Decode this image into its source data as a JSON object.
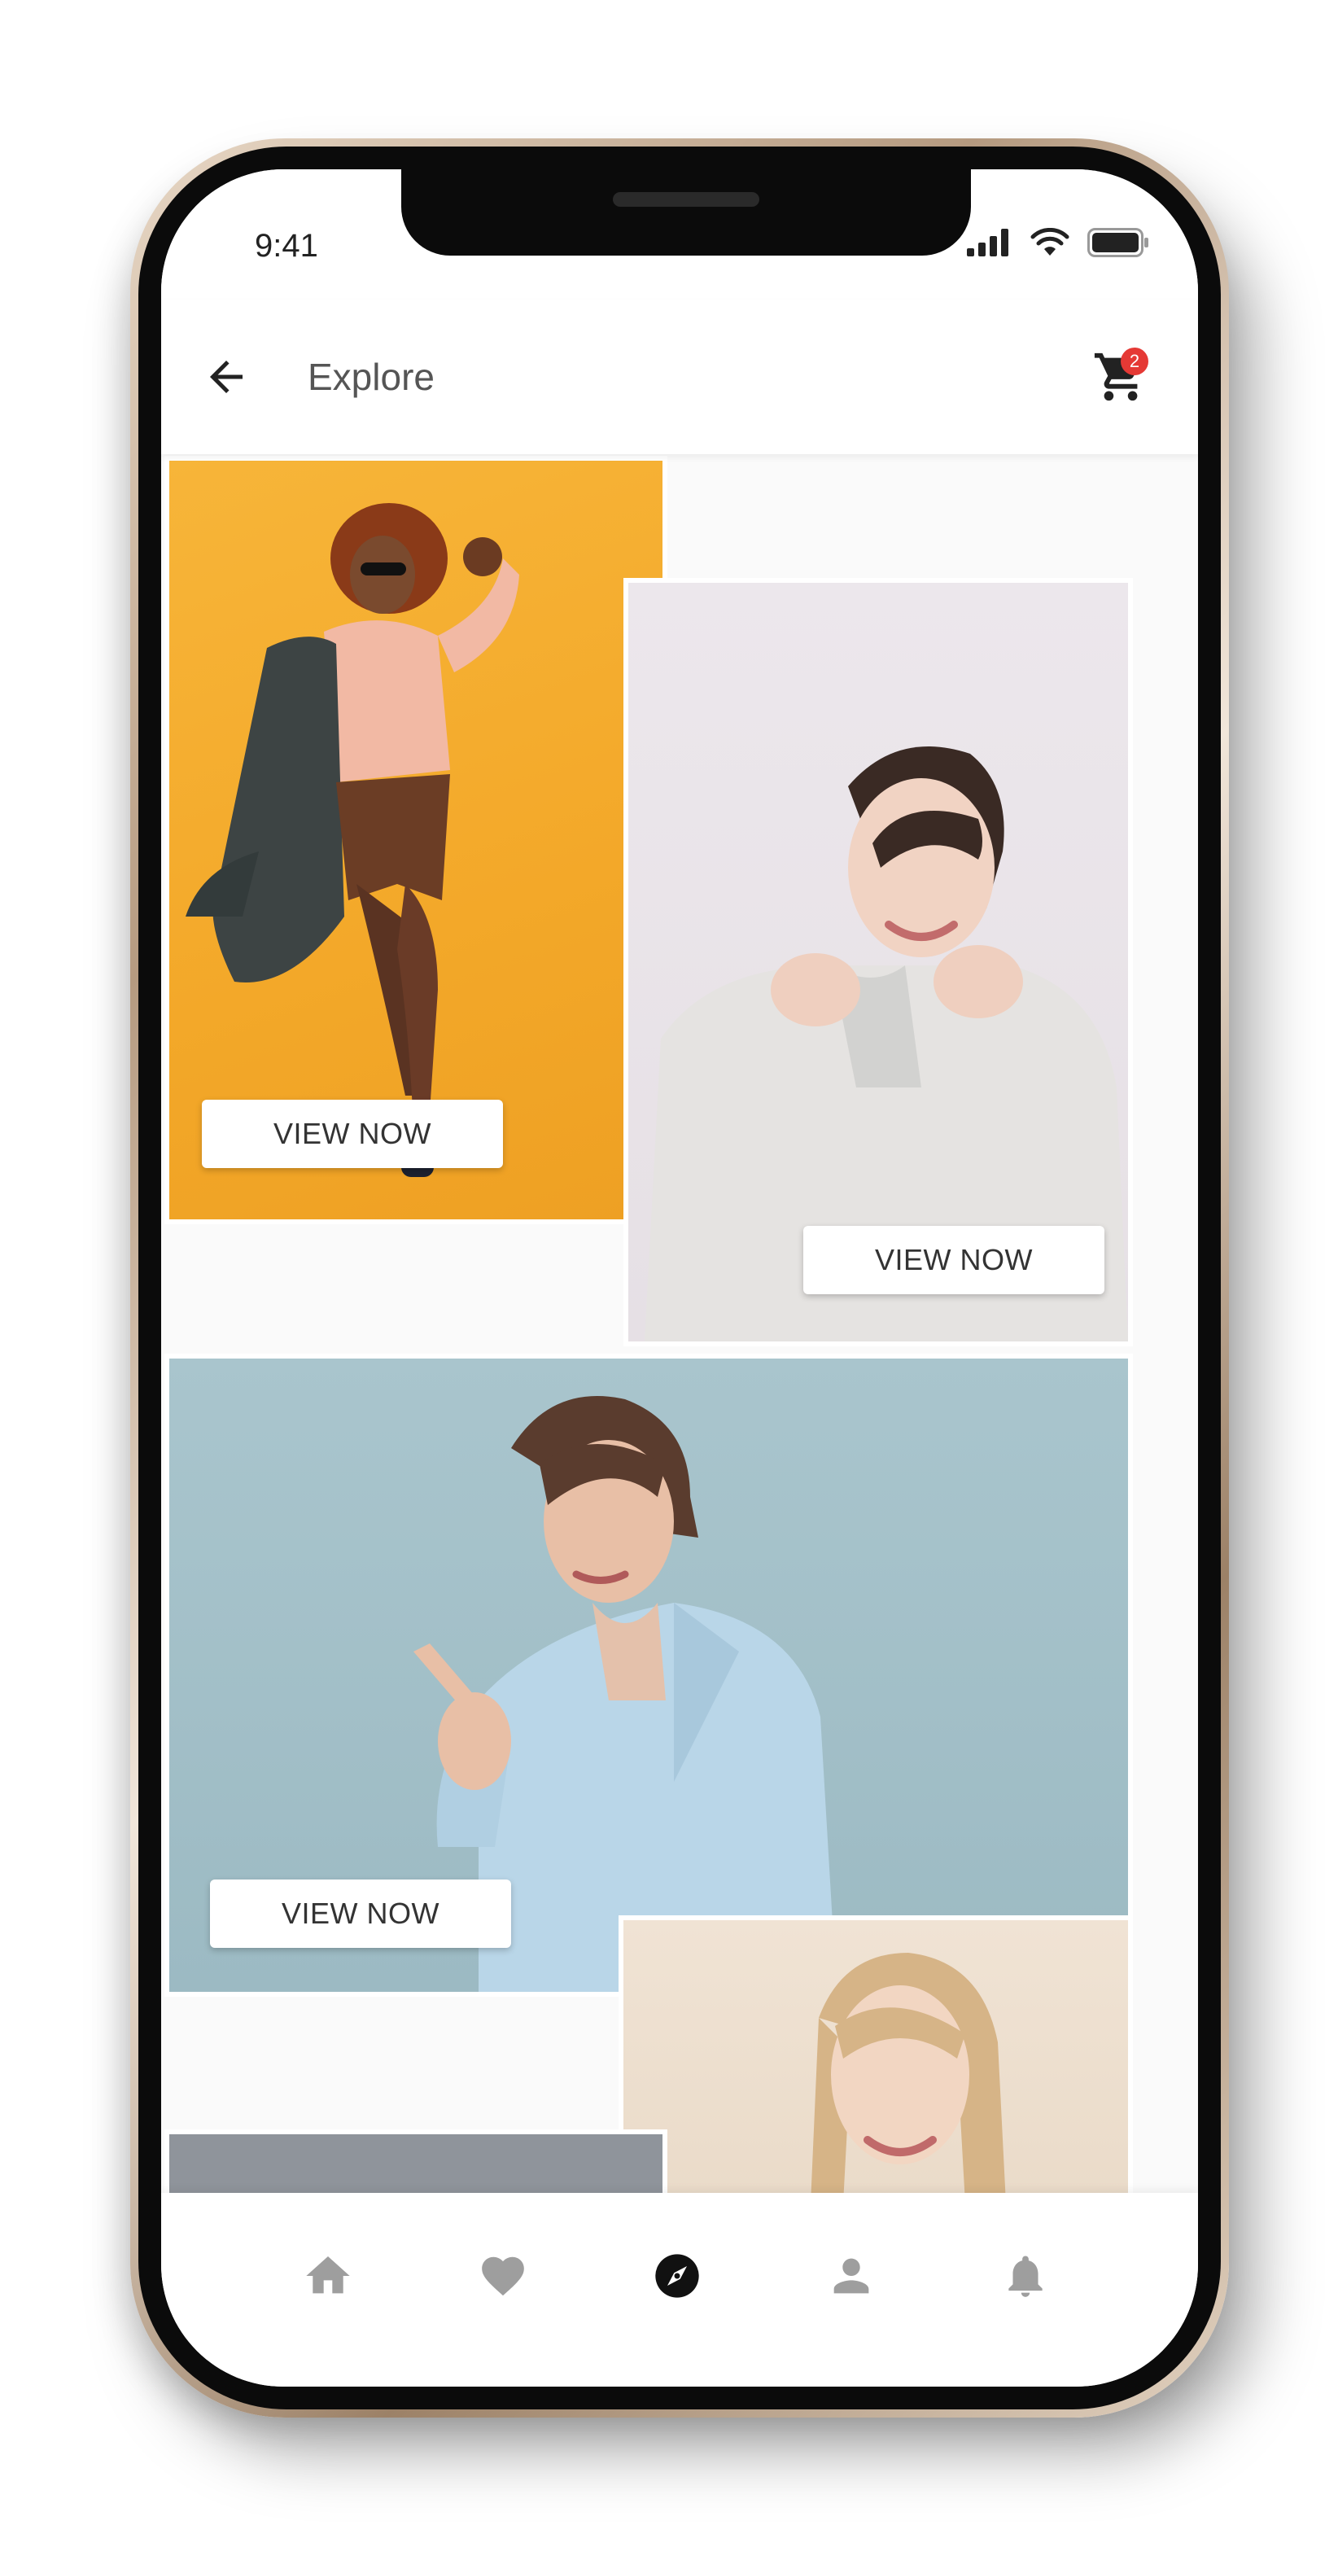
{
  "status_bar": {
    "time": "9:41"
  },
  "header": {
    "title": "Explore",
    "cart_badge_count": "2"
  },
  "feed": {
    "cards": [
      {
        "button_label": "VIEW NOW"
      },
      {
        "button_label": "VIEW NOW"
      },
      {
        "button_label": "VIEW NOW"
      }
    ]
  },
  "bottom_nav": {
    "items": [
      {
        "icon": "home-icon",
        "active": false
      },
      {
        "icon": "heart-icon",
        "active": false
      },
      {
        "icon": "compass-icon",
        "active": true
      },
      {
        "icon": "person-icon",
        "active": false
      },
      {
        "icon": "bell-icon",
        "active": false
      }
    ]
  },
  "colors": {
    "accent_badge": "#e53935",
    "nav_inactive": "#9e9e9e",
    "nav_active": "#111111",
    "card_1_bg": "#f3a829",
    "card_2_bg": "#e9e3e8",
    "card_3_bg": "#a3c0c8",
    "card_4_bg": "#eddfce"
  }
}
